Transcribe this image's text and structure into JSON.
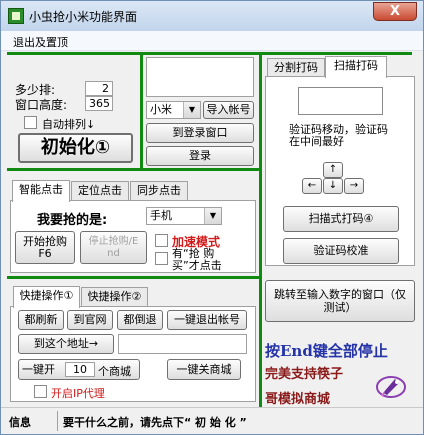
{
  "window": {
    "title": "小虫抢小米功能界面",
    "close_label": "X"
  },
  "menu": {
    "items": [
      "退出及置顶"
    ]
  },
  "left_top": {
    "multi_row_label": "多少排:",
    "multi_row_value": "2",
    "window_height_label": "窗口高度:",
    "window_height_value": "365",
    "auto_arrange_label": "自动排列↓",
    "init_button": "初始化①"
  },
  "login": {
    "account_select": "小米",
    "import_button": "导入帐号",
    "to_login_button": "到登录窗口",
    "login_button": "登录"
  },
  "click_tabs": [
    "智能点击",
    "定位点击",
    "同步点击"
  ],
  "grab": {
    "want_label": "我要抢的是:",
    "product_select": "手机",
    "start_button_line1": "开始抢购",
    "start_button_line2": "F6",
    "stop_button_line1": "停止抢购/E",
    "stop_button_line2": "nd",
    "speed_mode_label": "加速模式",
    "has_buy_label": "有“抢 购 买”才点击"
  },
  "quick_tabs": [
    "快捷操作①",
    "快捷操作②"
  ],
  "quick": {
    "refresh": "都刷新",
    "to_site": "到官网",
    "back": "都倒退",
    "logout": "一键退出帐号",
    "to_address": "到这个地址→",
    "open_prefix": "一键开",
    "open_count": "10",
    "open_suffix": "个商城",
    "close_mall": "一键关商城",
    "ip_proxy_label": "开启IP代理"
  },
  "captcha_tabs": [
    "分割打码",
    "扫描打码"
  ],
  "captcha": {
    "hint": "验证码移动，验证码在中间最好",
    "arrow_up": "↑",
    "arrow_left": "←",
    "arrow_down": "↓",
    "arrow_right": "→",
    "scan_button": "扫描式打码④",
    "calibrate_button": "验证码校准"
  },
  "jump_button": "跳转至输入数字的窗口（仅测试）",
  "promo": {
    "end_key": "按End键全部停止",
    "support": "完美支持筷子",
    "brother": "哥模拟商城"
  },
  "status": {
    "label": "信息",
    "message": "要干什么之前，请先点下“ 初 始 化 ”"
  },
  "colors": {
    "separator": "#118a11",
    "end_key_text": "#2433a8",
    "support_text": "#8b1a1a",
    "speed_mode": "#d11a1a"
  }
}
